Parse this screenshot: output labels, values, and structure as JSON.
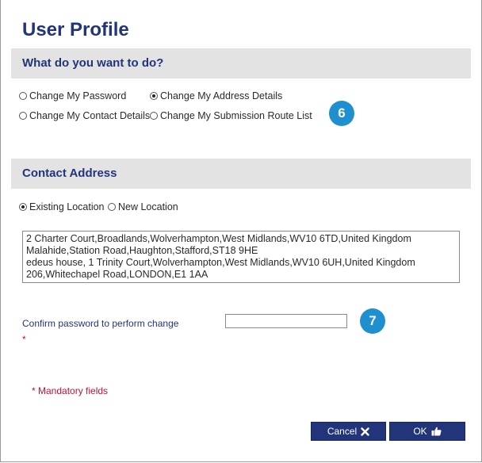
{
  "page": {
    "title": "User Profile"
  },
  "action_section": {
    "heading": "What do you want to do?",
    "options": [
      {
        "label": "Change My Password",
        "selected": false
      },
      {
        "label": "Change My Address Details",
        "selected": true
      },
      {
        "label": "Change My Contact Details",
        "selected": false
      },
      {
        "label": "Change My Submission Route List",
        "selected": false
      }
    ]
  },
  "badges": {
    "first": "6",
    "second": "7",
    "color": "#1f8fd0"
  },
  "address_section": {
    "heading": "Contact Address",
    "location_options": [
      {
        "label": "Existing Location",
        "selected": true
      },
      {
        "label": "New Location",
        "selected": false
      }
    ],
    "addresses": [
      "2 Charter Court,Broadlands,Wolverhampton,West Midlands,WV10 6TD,United Kingdom",
      "Malahide,Station Road,Haughton,Stafford,ST18 9HE",
      "edeus house, 1 Trinity Court,Wolverhampton,West Midlands,WV10 6UH,United Kingdom",
      "206,Whitechapel Road,LONDON,E1 1AA"
    ]
  },
  "confirm": {
    "label": "Confirm password to perform change",
    "required_mark": "*",
    "value": ""
  },
  "mandatory_note": "* Mandatory fields",
  "buttons": {
    "cancel_label": "Cancel",
    "cancel_icon": "close-icon",
    "ok_label": "OK",
    "ok_icon": "thumbs-up-icon"
  },
  "colors": {
    "heading": "#23357a",
    "section_bar": "#e3e3e3",
    "required": "#c8102e",
    "button": "#23357a"
  }
}
